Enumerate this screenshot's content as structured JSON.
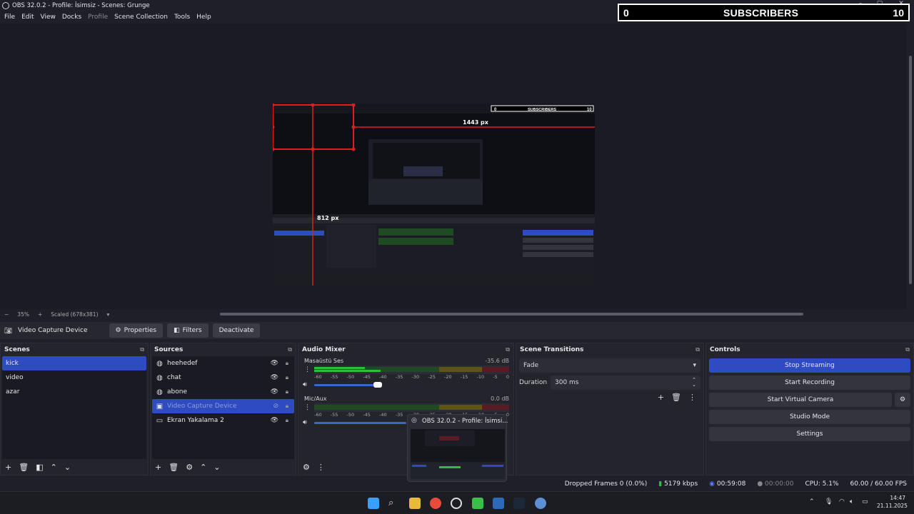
{
  "window": {
    "title": "OBS 32.0.2 - Profile: İsimsiz - Scenes: Grunge"
  },
  "menu": {
    "file": "File",
    "edit": "Edit",
    "view": "View",
    "docks": "Docks",
    "profile": "Profile",
    "scene_collection": "Scene Collection",
    "tools": "Tools",
    "help": "Help"
  },
  "overlay": {
    "left": "0",
    "label": "SUBSCRIBERS",
    "right": "10"
  },
  "preview": {
    "width_label": "1443 px",
    "height_label": "812 px",
    "inner_subs_label": "SUBSCRIBERS",
    "inner_subs_left": "0",
    "inner_subs_right": "10"
  },
  "zoom": {
    "minus": "−",
    "value": "35%",
    "plus": "+",
    "mode": "Scaled (678x381)"
  },
  "source_bar": {
    "source_name": "Video Capture Device",
    "properties": "Properties",
    "filters": "Filters",
    "deactivate": "Deactivate"
  },
  "scenes": {
    "title": "Scenes",
    "items": [
      "kick",
      "video",
      "azar"
    ]
  },
  "sources": {
    "title": "Sources",
    "items": [
      "heehedef",
      "chat",
      "abone",
      "Video Capture Device",
      "Ekran Yakalama 2"
    ]
  },
  "mixer": {
    "title": "Audio Mixer",
    "channels": [
      {
        "name": "Masaüstü Ses",
        "db": "-35.6 dB",
        "level": 0.22
      },
      {
        "name": "Mic/Aux",
        "db": "0.0 dB",
        "level": 0.0
      }
    ],
    "ticks": [
      "-60",
      "-55",
      "-50",
      "-45",
      "-40",
      "-35",
      "-30",
      "-25",
      "-20",
      "-15",
      "-10",
      "-5",
      "0"
    ]
  },
  "transitions": {
    "title": "Scene Transitions",
    "selected": "Fade",
    "duration_label": "Duration",
    "duration_value": "300 ms"
  },
  "controls": {
    "title": "Controls",
    "stop_streaming": "Stop Streaming",
    "start_recording": "Start Recording",
    "start_virtual_camera": "Start Virtual Camera",
    "studio_mode": "Studio Mode",
    "settings": "Settings"
  },
  "taskbar_popup": {
    "title": "OBS 32.0.2 - Profile: İsimsi..."
  },
  "status": {
    "dropped": "Dropped Frames 0 (0.0%)",
    "bitrate": "5179 kbps",
    "stream_time": "00:59:08",
    "rec_time": "00:00:00",
    "cpu": "CPU: 5.1%",
    "fps": "60.00 / 60.00 FPS"
  },
  "clock": {
    "time": "14:47",
    "date": "21.11.2025"
  },
  "colors": {
    "accent": "#2f4bc2",
    "meter_green": "#2bbf3a",
    "guide_red": "#e01e1e"
  }
}
